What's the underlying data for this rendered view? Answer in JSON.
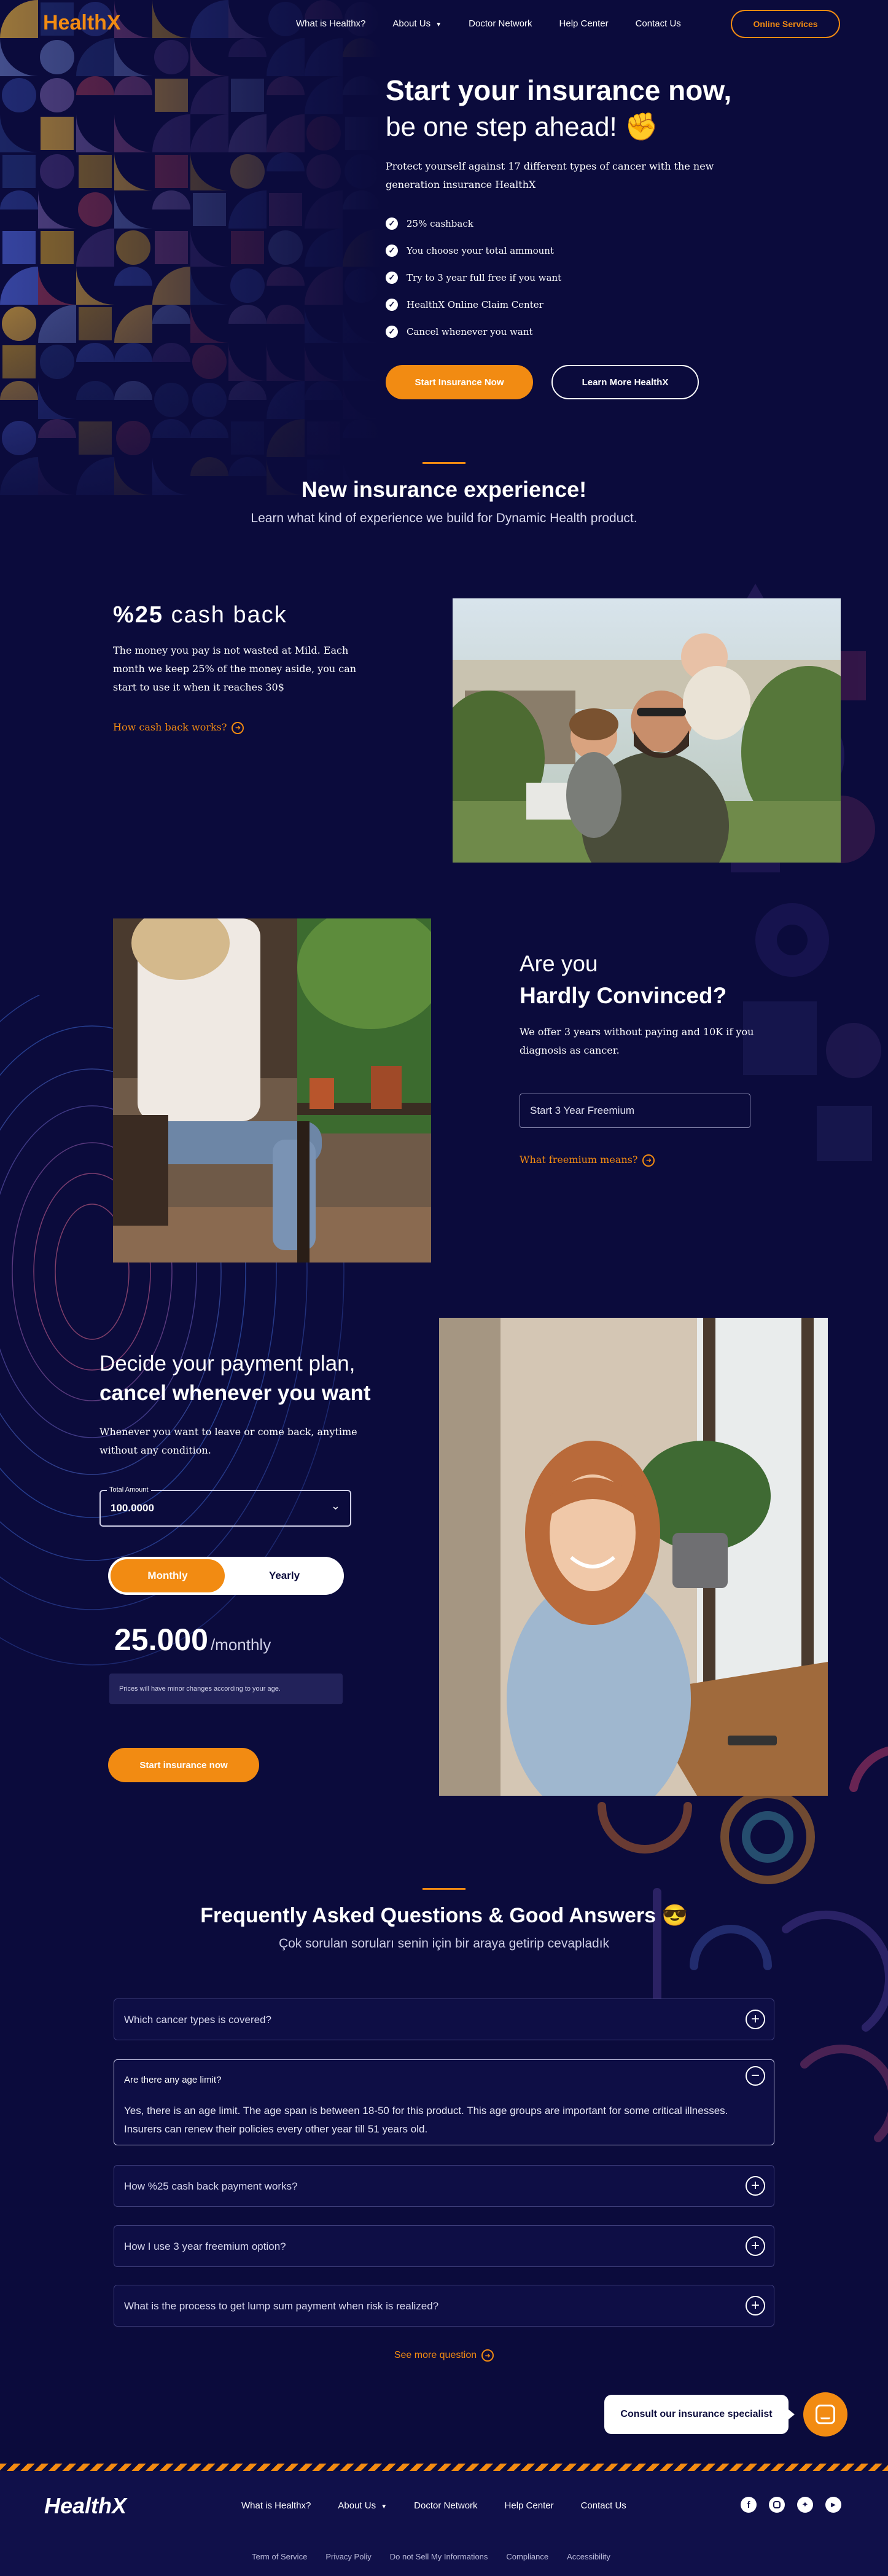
{
  "brand": {
    "name": "HealthX",
    "accent": "#f28b12",
    "bg": "#0b0b3c"
  },
  "nav": {
    "items": [
      "What is Healthx?",
      "About Us",
      "Doctor Network",
      "Help Center",
      "Contact Us"
    ],
    "cta": "Online Services"
  },
  "hero": {
    "title_line1": "Start your insurance now,",
    "title_line2": "be one step ahead! ✊",
    "subtitle": "Protect yourself against 17 different types of cancer with the new generation insurance HealthX",
    "features": [
      "25% cashback",
      "You choose your total ammount",
      "Try to 3 year full free if you want",
      "HealthX Online Claim Center",
      "Cancel whenever you want"
    ],
    "primary_btn": "Start Insurance Now",
    "secondary_btn": "Learn More HealthX"
  },
  "experience": {
    "title": "New insurance experience!",
    "subtitle": "Learn what kind of experience we build for Dynamic Health product."
  },
  "cashback": {
    "title_bold": "%25",
    "title_rest": " cash back",
    "body": "The money you pay is not wasted at Mild. Each month we keep 25% of the money aside, you can start to use it when it reaches 30$",
    "link": "How cash back works?"
  },
  "convinced": {
    "line1": "Are you",
    "line2": "Hardly Convinced?",
    "body": "We offer 3 years without paying and 10K if you diagnosis as cancer.",
    "input_placeholder": "Start 3 Year Freemium",
    "link": "What freemium means?"
  },
  "payment": {
    "line1": "Decide your payment plan,",
    "line2": "cancel whenever you want",
    "body": "Whenever you want to leave or come back, anytime without any condition.",
    "field_label": "Total Amount",
    "field_value": "100.0000",
    "toggle": [
      "Monthly",
      "Yearly"
    ],
    "price": "25.000",
    "period": "/monthly",
    "note": "Prices will have minor changes according to your age.",
    "cta": "Start insurance now"
  },
  "faq": {
    "title": "Frequently Asked Questions &  Good Answers 😎",
    "subtitle": "Çok sorulan soruları senin için bir araya getirip cevapladık",
    "items": [
      {
        "q": "Which cancer types is covered?"
      },
      {
        "q": "Are there any age limit?",
        "a": "Yes, there is an age limit. The age span is between 18-50 for this product. This age groups are important for some critical illnesses. Insurers can renew their policies every other year till 51 years old."
      },
      {
        "q": "How %25 cash back payment works?"
      },
      {
        "q": "How I use 3 year freemium option?"
      },
      {
        "q": "What is the process to get lump sum payment when risk is realized?"
      }
    ],
    "more": "See more question"
  },
  "consult": {
    "label": "Consult our insurance specialist"
  },
  "footer": {
    "nav": [
      "What is Healthx?",
      "About Us",
      "Doctor Network",
      "Help Center",
      "Contact Us"
    ],
    "social": [
      "facebook-icon",
      "instagram-icon",
      "twitter-icon",
      "youtube-icon"
    ],
    "legal": [
      "Term of Service",
      "Privacy Poliy",
      "Do not Sell My Informations",
      "Compliance",
      "Accessibility"
    ]
  }
}
